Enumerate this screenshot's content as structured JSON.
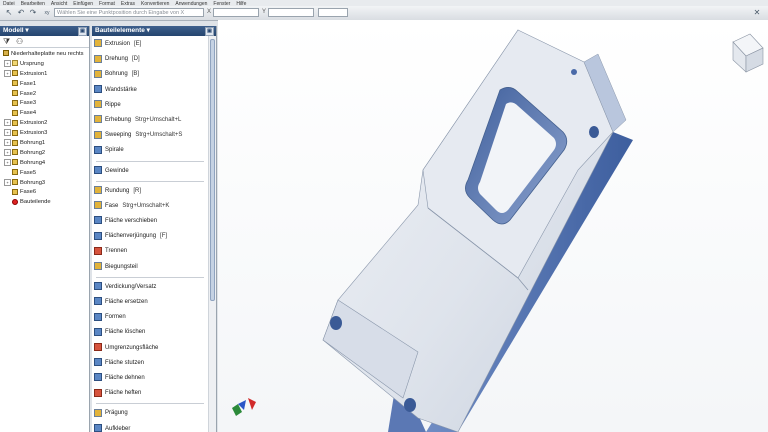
{
  "menubar": {
    "items": [
      "Datei",
      "Bearbeiten",
      "Ansicht",
      "Einfügen",
      "Format",
      "Extras",
      "Konvertieren",
      "Anwendungen",
      "Fenster",
      "Hilfe"
    ]
  },
  "toolbar": {
    "sketch_prompt": "Wählen Sie eine Punktposition durch Eingabe von X",
    "x_label": "X",
    "y_label": "Y"
  },
  "model_panel": {
    "title": "Modell",
    "tree": [
      {
        "label": "Niederhalteplatte neu rechts",
        "icon": "part-icon",
        "indent": 0,
        "expandable": false
      },
      {
        "label": "Ursprung",
        "icon": "folder-icon",
        "indent": 1,
        "expandable": true
      },
      {
        "label": "Extrusion1",
        "icon": "extrusion-icon",
        "indent": 1,
        "expandable": true
      },
      {
        "label": "Fase1",
        "icon": "chamfer-icon",
        "indent": 1,
        "expandable": false
      },
      {
        "label": "Fase2",
        "icon": "chamfer-icon",
        "indent": 1,
        "expandable": false
      },
      {
        "label": "Fase3",
        "icon": "chamfer-icon",
        "indent": 1,
        "expandable": false
      },
      {
        "label": "Fase4",
        "icon": "chamfer-icon",
        "indent": 1,
        "expandable": false
      },
      {
        "label": "Extrusion2",
        "icon": "extrusion-icon",
        "indent": 1,
        "expandable": true
      },
      {
        "label": "Extrusion3",
        "icon": "extrusion-icon",
        "indent": 1,
        "expandable": true
      },
      {
        "label": "Bohrung1",
        "icon": "hole-icon",
        "indent": 1,
        "expandable": true
      },
      {
        "label": "Bohrung2",
        "icon": "hole-icon",
        "indent": 1,
        "expandable": true
      },
      {
        "label": "Bohrung4",
        "icon": "hole-icon",
        "indent": 1,
        "expandable": true
      },
      {
        "label": "Fase5",
        "icon": "chamfer-icon",
        "indent": 1,
        "expandable": false
      },
      {
        "label": "Bohrung3",
        "icon": "hole-icon",
        "indent": 1,
        "expandable": true
      },
      {
        "label": "Fase6",
        "icon": "chamfer-icon",
        "indent": 1,
        "expandable": false
      },
      {
        "label": "Bauteilende",
        "icon": "end-of-part-icon",
        "indent": 1,
        "expandable": false
      }
    ]
  },
  "feature_panel": {
    "title": "Bauteilelemente",
    "groups": [
      [
        {
          "label": "Extrusion",
          "shortcut": "[E]",
          "icon": "extrusion-icon",
          "color": "orange"
        },
        {
          "label": "Drehung",
          "shortcut": "[D]",
          "icon": "revolve-icon",
          "color": "orange"
        },
        {
          "label": "Bohrung",
          "shortcut": "[B]",
          "icon": "hole-icon",
          "color": "orange"
        },
        {
          "label": "Wandstärke",
          "shortcut": "",
          "icon": "shell-icon",
          "color": "blue"
        },
        {
          "label": "Rippe",
          "shortcut": "",
          "icon": "rib-icon",
          "color": "orange"
        },
        {
          "label": "Erhebung",
          "shortcut": "Strg+Umschalt+L",
          "icon": "loft-icon",
          "color": "orange"
        },
        {
          "label": "Sweeping",
          "shortcut": "Strg+Umschalt+S",
          "icon": "sweep-icon",
          "color": "orange"
        },
        {
          "label": "Spirale",
          "shortcut": "",
          "icon": "coil-icon",
          "color": "blue"
        }
      ],
      [
        {
          "label": "Gewinde",
          "shortcut": "",
          "icon": "thread-icon",
          "color": "blue"
        }
      ],
      [
        {
          "label": "Rundung",
          "shortcut": "[R]",
          "icon": "fillet-icon",
          "color": "orange"
        },
        {
          "label": "Fase",
          "shortcut": "Strg+Umschalt+K",
          "icon": "chamfer-icon",
          "color": "orange"
        },
        {
          "label": "Fläche verschieben",
          "shortcut": "",
          "icon": "move-face-icon",
          "color": "blue"
        },
        {
          "label": "Flächenverjüngung",
          "shortcut": "[F]",
          "icon": "face-draft-icon",
          "color": "blue"
        },
        {
          "label": "Trennen",
          "shortcut": "",
          "icon": "split-icon",
          "color": "red"
        },
        {
          "label": "Biegungsteil",
          "shortcut": "",
          "icon": "bend-part-icon",
          "color": "orange"
        }
      ],
      [
        {
          "label": "Verdickung/Versatz",
          "shortcut": "",
          "icon": "thicken-icon",
          "color": "blue"
        },
        {
          "label": "Fläche ersetzen",
          "shortcut": "",
          "icon": "replace-face-icon",
          "color": "blue"
        },
        {
          "label": "Formen",
          "shortcut": "",
          "icon": "sculpt-icon",
          "color": "blue"
        },
        {
          "label": "Fläche löschen",
          "shortcut": "",
          "icon": "delete-face-icon",
          "color": "blue"
        },
        {
          "label": "Umgrenzungsfläche",
          "shortcut": "",
          "icon": "boundary-patch-icon",
          "color": "red"
        },
        {
          "label": "Fläche stutzen",
          "shortcut": "",
          "icon": "trim-surface-icon",
          "color": "blue"
        },
        {
          "label": "Fläche dehnen",
          "shortcut": "",
          "icon": "extend-surface-icon",
          "color": "blue"
        },
        {
          "label": "Fläche heften",
          "shortcut": "",
          "icon": "stitch-surface-icon",
          "color": "red"
        }
      ],
      [
        {
          "label": "Prägung",
          "shortcut": "",
          "icon": "emboss-icon",
          "color": "orange"
        },
        {
          "label": "Aufkleber",
          "shortcut": "",
          "icon": "decal-icon",
          "color": "blue"
        }
      ]
    ]
  },
  "colors": {
    "panel_header": "#2e4f7c",
    "model_face": "#dde3ec",
    "model_side": "#4a6aa8"
  }
}
